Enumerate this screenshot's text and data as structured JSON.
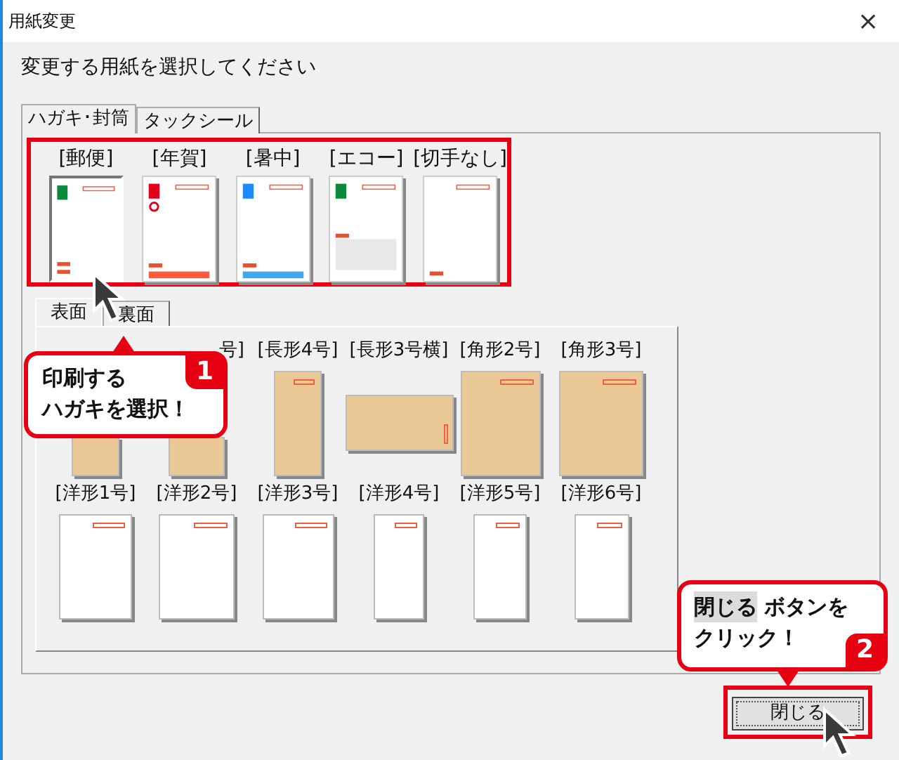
{
  "window": {
    "title": "用紙変更",
    "close": "×"
  },
  "instruction": "変更する用紙を選択してください",
  "tabs": [
    {
      "label": "ハガキ･封筒",
      "selected": true
    },
    {
      "label": "タックシール",
      "selected": false
    }
  ],
  "postcards": [
    {
      "label": "[郵便]",
      "kind": "stamp",
      "color": "#0a8a3a",
      "selected": true
    },
    {
      "label": "[年賀]",
      "kind": "new-year",
      "color": "#e0001b",
      "selected": false
    },
    {
      "label": "[暑中]",
      "kind": "summer",
      "color": "#1e88ff",
      "selected": false
    },
    {
      "label": "[エコー]",
      "kind": "eco",
      "color": "#0a8a3a",
      "selected": false
    },
    {
      "label": "[切手なし]",
      "kind": "plain",
      "selected": false
    }
  ],
  "side_tabs": [
    {
      "label": "表面",
      "selected": true
    },
    {
      "label": "裏面",
      "selected": false
    }
  ],
  "envelopes": [
    {
      "kind": "kraft"
    },
    {
      "label": "号]",
      "kind": "kraft"
    },
    {
      "label": "[長形4号]",
      "kind": "kraft"
    },
    {
      "label": "[長形3号横]",
      "kind": "kraft-landscape"
    },
    {
      "label": "[角形2号]",
      "kind": "kraft"
    },
    {
      "label": "[角形3号]",
      "kind": "kraft"
    },
    {
      "label": "[洋形1号]",
      "kind": "white"
    },
    {
      "label": "[洋形2号]",
      "kind": "white"
    },
    {
      "label": "[洋形3号]",
      "kind": "white"
    },
    {
      "label": "[洋形4号]",
      "kind": "white"
    },
    {
      "label": "[洋形5号]",
      "kind": "white"
    },
    {
      "label": "[洋形6号]",
      "kind": "white"
    }
  ],
  "close_button": "閉じる",
  "callouts": [
    {
      "number": "1",
      "lines": [
        "印刷する",
        "ハガキを選択！"
      ]
    },
    {
      "number": "2",
      "highlight": "閉じる",
      "lines": [
        " ボタンを",
        "クリック！"
      ]
    }
  ]
}
